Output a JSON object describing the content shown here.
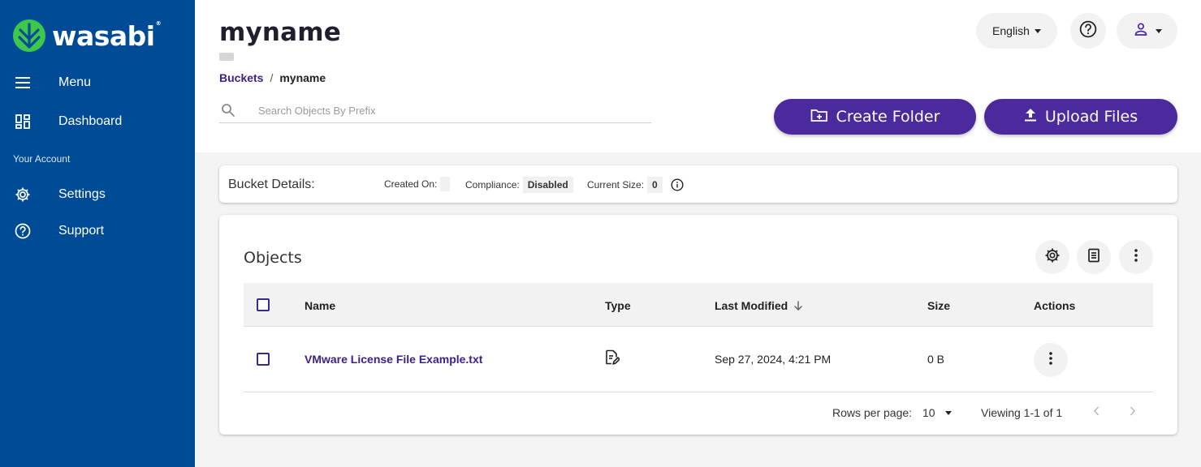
{
  "brand": {
    "name": "wasabi",
    "trademark": "®",
    "logo_color": "#3ec84b",
    "sidebar_color": "#004b96",
    "accent_color": "#4b2a9d"
  },
  "sidebar": {
    "items": [
      {
        "label": "Menu",
        "icon": "hamburger-icon"
      },
      {
        "label": "Dashboard",
        "icon": "dashboard-icon"
      }
    ],
    "section_label": "Your Account",
    "account_items": [
      {
        "label": "Settings",
        "icon": "gear-icon"
      },
      {
        "label": "Support",
        "icon": "help-circle-icon"
      }
    ]
  },
  "header": {
    "title": "myname",
    "breadcrumb": {
      "parent": "Buckets",
      "separator": "/",
      "current": "myname"
    },
    "language": "English",
    "search_placeholder": "Search Objects By Prefix",
    "create_folder_label": "Create Folder",
    "upload_files_label": "Upload Files"
  },
  "bucket_details": {
    "title": "Bucket Details:",
    "created_on_label": "Created On:",
    "created_on_value": "",
    "compliance_label": "Compliance:",
    "compliance_value": "Disabled",
    "current_size_label": "Current Size:",
    "current_size_value": "0"
  },
  "objects": {
    "title": "Objects",
    "columns": {
      "name": "Name",
      "type": "Type",
      "last_modified": "Last Modified",
      "size": "Size",
      "actions": "Actions"
    },
    "rows": [
      {
        "name": "VMware License File Example.txt",
        "type_icon": "text-file-icon",
        "last_modified": "Sep 27, 2024, 4:21 PM",
        "size": "0 B"
      }
    ],
    "pagination": {
      "rows_per_page_label": "Rows per page:",
      "rows_per_page": "10",
      "viewing": "Viewing 1-1 of 1"
    }
  }
}
